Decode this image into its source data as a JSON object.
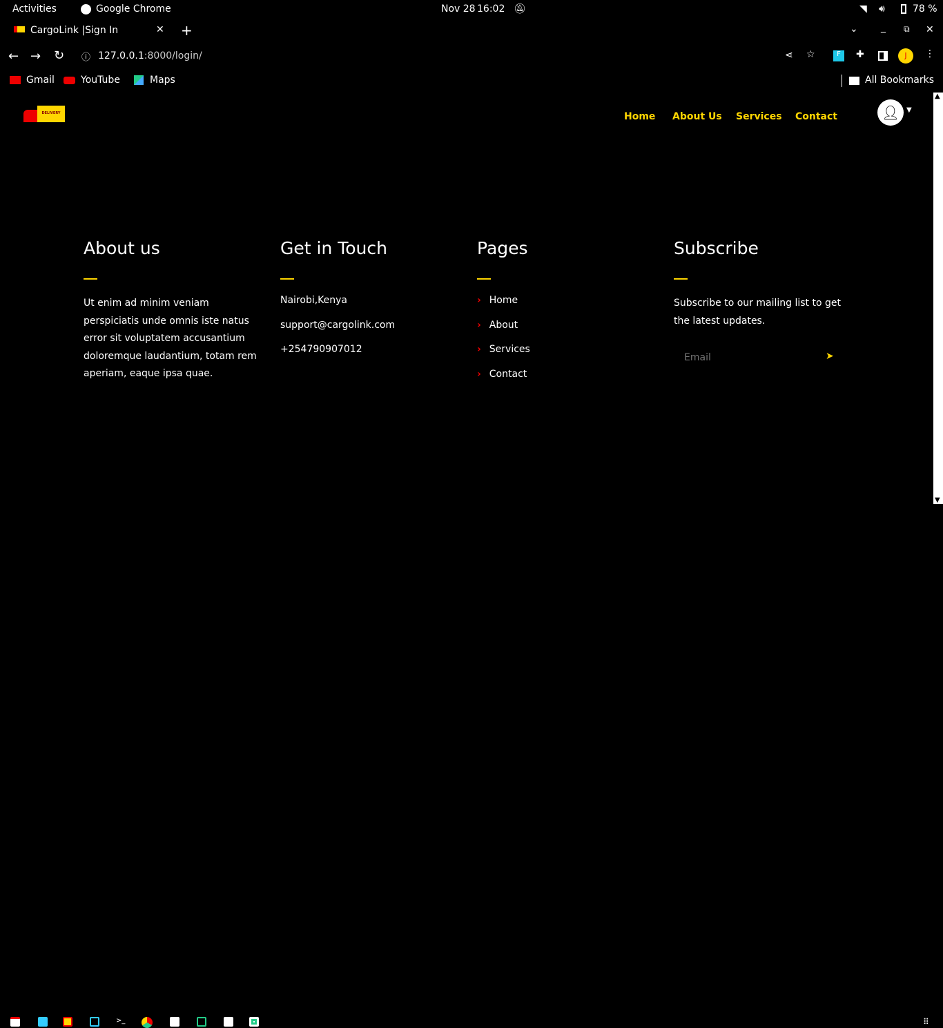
{
  "system": {
    "activities": "Activities",
    "app": "Google Chrome",
    "date": "Nov 28",
    "time": "16:02",
    "battery": "78 %"
  },
  "browser": {
    "tab_title": "CargoLink |Sign In",
    "url_host": "127.0.0.1",
    "url_rest": ":8000/login/",
    "bookmarks": [
      "Gmail",
      "YouTube",
      "Maps"
    ],
    "all_bookmarks": "All Bookmarks",
    "profile_initial": "J"
  },
  "site": {
    "logo_text": "DELIVERY",
    "nav": [
      "Home",
      "About Us",
      "Services",
      "Contact"
    ]
  },
  "footer": {
    "about": {
      "title": "About us",
      "text": "Ut enim ad minim veniam perspiciatis unde omnis iste natus error sit voluptatem accusantium doloremque laudantium, totam rem aperiam, eaque ipsa quae."
    },
    "contact": {
      "title": "Get in Touch",
      "location": "Nairobi,Kenya",
      "email": "support@cargolink.com",
      "phone": "+254790907012"
    },
    "pages": {
      "title": "Pages",
      "links": [
        "Home",
        "About",
        "Services",
        "Contact"
      ]
    },
    "subscribe": {
      "title": "Subscribe",
      "text": "Subscribe to our mailing list to get the latest updates.",
      "placeholder": "Email"
    }
  },
  "colors": {
    "accent": "#ffd600",
    "chevron": "#e00000"
  }
}
